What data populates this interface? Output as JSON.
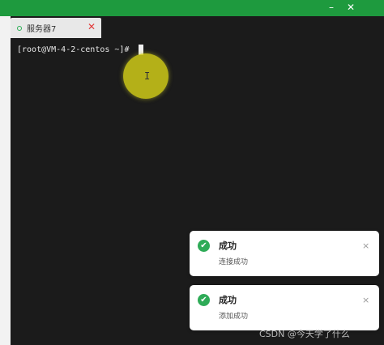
{
  "window": {
    "minimize_glyph": "–",
    "close_glyph": "✕",
    "accent": "#1e9a3e"
  },
  "tab": {
    "label": "服务器7",
    "status_color": "#2bae55",
    "close_glyph": "✕"
  },
  "terminal": {
    "prompt": "[root@VM-4-2-centos ~]#"
  },
  "toasts": [
    {
      "title": "成功",
      "message": "连接成功",
      "icon": "check-circle-icon",
      "close_glyph": "×"
    },
    {
      "title": "成功",
      "message": "添加成功",
      "icon": "check-circle-icon",
      "close_glyph": "×"
    }
  ],
  "watermark": "CSDN @今天学了什么"
}
